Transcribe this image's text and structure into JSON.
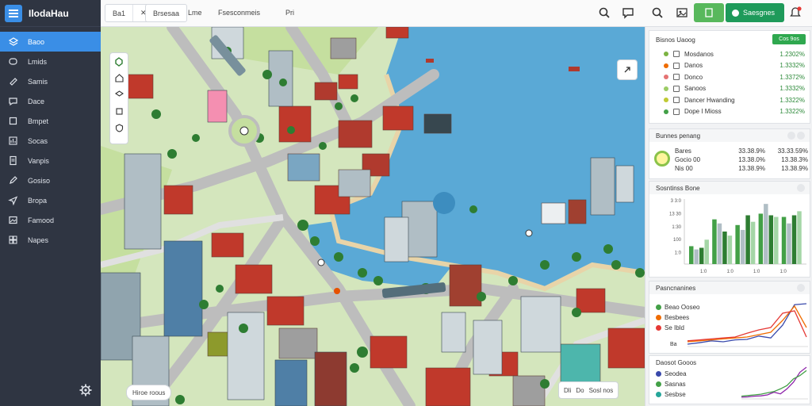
{
  "app": {
    "title": "IlodaHau"
  },
  "sidebar": {
    "items": [
      {
        "label": "Baoo",
        "icon": "layers-icon",
        "active": true
      },
      {
        "label": "Lmids",
        "icon": "chat-icon"
      },
      {
        "label": "Samis",
        "icon": "tag-icon"
      },
      {
        "label": "Dace",
        "icon": "comment-icon"
      },
      {
        "label": "Bmpet",
        "icon": "square-icon"
      },
      {
        "label": "Socas",
        "icon": "chart-icon"
      },
      {
        "label": "Vanpis",
        "icon": "document-icon"
      },
      {
        "label": "Gosiso",
        "icon": "edit-icon"
      },
      {
        "label": "Bropa",
        "icon": "send-icon"
      },
      {
        "label": "Famood",
        "icon": "image-icon"
      },
      {
        "label": "Napes",
        "icon": "grid-icon"
      }
    ]
  },
  "toolbar": {
    "btn1": "Ba1",
    "btn2": "Brsesaa",
    "btn3": "Lme",
    "btn4": "Fsesconmeis",
    "btn5": "Pri",
    "primary_label": "Saesgnes"
  },
  "map": {
    "status_text": "Hiroe roous",
    "zoom_a": "Dli",
    "zoom_b": "Do",
    "zoom_c": "Sosl nos"
  },
  "layers": {
    "title": "Bisnos Uaoog",
    "add_label": "Cos 9os",
    "items": [
      {
        "label": "Mosdanos",
        "value": "1.2302%",
        "color": "#7cb342"
      },
      {
        "label": "Danos",
        "value": "1.3332%",
        "color": "#ef6c00"
      },
      {
        "label": "Donco",
        "value": "1.3372%",
        "color": "#e57373"
      },
      {
        "label": "Sanoos",
        "value": "1.3332%",
        "color": "#9ccc65"
      },
      {
        "label": "Dancer Hwanding",
        "value": "1.3322%",
        "color": "#c0ca33"
      },
      {
        "label": "Dope I Mioss",
        "value": "1.3322%",
        "color": "#43a047"
      }
    ]
  },
  "summary": {
    "title": "Bunnes penang",
    "rows": [
      {
        "label": "Bares",
        "a": "33.38.9%",
        "b": "33.33.59%"
      },
      {
        "label": "Gocio 00",
        "a": "13.38.0%",
        "b": "13.38.3%"
      },
      {
        "label": "Nis 00",
        "a": "13.38.9%",
        "b": "13.38.9%"
      }
    ]
  },
  "bar_card": {
    "title": "Sosntinss Bone"
  },
  "line_card1": {
    "title": "Pasncnanines",
    "legend": [
      {
        "label": "Beao Ooseo",
        "color": "#43a047"
      },
      {
        "label": "Besbees",
        "color": "#ef6c00"
      },
      {
        "label": "Se Ibld",
        "color": "#e53935"
      }
    ],
    "note": "Ba"
  },
  "line_card2": {
    "title": "Daosot Gooos",
    "legend": [
      {
        "label": "Seodea",
        "color": "#3949ab"
      },
      {
        "label": "Sasnas",
        "color": "#43a047"
      },
      {
        "label": "Sesbse",
        "color": "#26a69a"
      }
    ]
  },
  "chart_data": [
    {
      "type": "bar",
      "title": "Sosntinss Bone",
      "y_tick_labels": [
        "3 3:0",
        "13 30",
        "1:30",
        "100",
        "1:0"
      ],
      "x_tick_labels": [
        "1:0",
        "1:0",
        "1:0",
        "1:0"
      ],
      "series": [
        {
          "color": "#43a047",
          "values": [
            22,
            55,
            48,
            62,
            58
          ]
        },
        {
          "color": "#b0bec5",
          "values": [
            18,
            50,
            42,
            74,
            50
          ]
        },
        {
          "color": "#2e7d32",
          "values": [
            20,
            40,
            60,
            60,
            60
          ]
        },
        {
          "color": "#a5d6a7",
          "values": [
            30,
            35,
            52,
            58,
            65
          ]
        }
      ],
      "ylim": [
        0,
        80
      ]
    },
    {
      "type": "line",
      "title": "Pasncnanines",
      "series": [
        {
          "color": "#3949ab",
          "values": [
            5,
            8,
            12,
            10,
            14,
            15,
            22,
            18,
            45,
            88,
            90
          ]
        },
        {
          "color": "#ef6c00",
          "values": [
            10,
            12,
            14,
            16,
            18,
            20,
            25,
            30,
            55,
            85,
            40
          ]
        },
        {
          "color": "#e53935",
          "values": [
            12,
            14,
            16,
            18,
            20,
            28,
            35,
            40,
            70,
            75,
            20
          ]
        }
      ],
      "ylim": [
        0,
        100
      ]
    },
    {
      "type": "line",
      "title": "Daosot Gooos",
      "series": [
        {
          "color": "#8e24aa",
          "values": [
            5,
            6,
            8,
            9,
            12,
            20,
            15,
            30,
            50,
            80,
            95
          ]
        },
        {
          "color": "#43a047",
          "values": [
            8,
            10,
            12,
            14,
            18,
            22,
            30,
            40,
            60,
            70,
            85
          ]
        }
      ],
      "ylim": [
        0,
        100
      ]
    }
  ]
}
